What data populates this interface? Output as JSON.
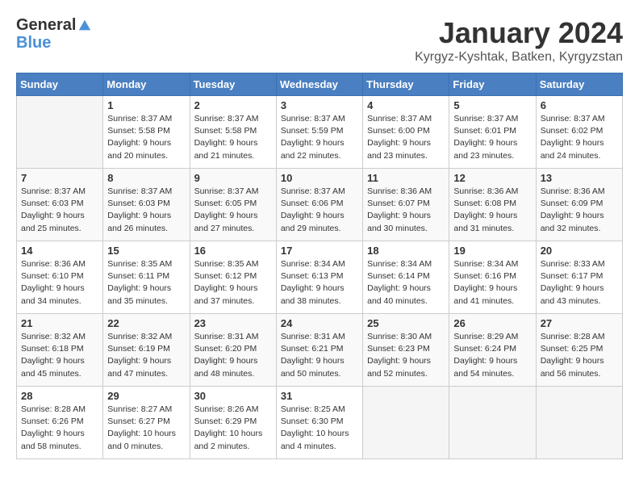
{
  "logo": {
    "line1": "General",
    "line2": "Blue"
  },
  "title": "January 2024",
  "location": "Kyrgyz-Kyshtak, Batken, Kyrgyzstan",
  "weekdays": [
    "Sunday",
    "Monday",
    "Tuesday",
    "Wednesday",
    "Thursday",
    "Friday",
    "Saturday"
  ],
  "weeks": [
    [
      {
        "day": "",
        "info": ""
      },
      {
        "day": "1",
        "info": "Sunrise: 8:37 AM\nSunset: 5:58 PM\nDaylight: 9 hours\nand 20 minutes."
      },
      {
        "day": "2",
        "info": "Sunrise: 8:37 AM\nSunset: 5:58 PM\nDaylight: 9 hours\nand 21 minutes."
      },
      {
        "day": "3",
        "info": "Sunrise: 8:37 AM\nSunset: 5:59 PM\nDaylight: 9 hours\nand 22 minutes."
      },
      {
        "day": "4",
        "info": "Sunrise: 8:37 AM\nSunset: 6:00 PM\nDaylight: 9 hours\nand 23 minutes."
      },
      {
        "day": "5",
        "info": "Sunrise: 8:37 AM\nSunset: 6:01 PM\nDaylight: 9 hours\nand 23 minutes."
      },
      {
        "day": "6",
        "info": "Sunrise: 8:37 AM\nSunset: 6:02 PM\nDaylight: 9 hours\nand 24 minutes."
      }
    ],
    [
      {
        "day": "7",
        "info": ""
      },
      {
        "day": "8",
        "info": "Sunrise: 8:37 AM\nSunset: 6:03 PM\nDaylight: 9 hours\nand 26 minutes."
      },
      {
        "day": "9",
        "info": "Sunrise: 8:37 AM\nSunset: 6:05 PM\nDaylight: 9 hours\nand 27 minutes."
      },
      {
        "day": "10",
        "info": "Sunrise: 8:37 AM\nSunset: 6:06 PM\nDaylight: 9 hours\nand 29 minutes."
      },
      {
        "day": "11",
        "info": "Sunrise: 8:36 AM\nSunset: 6:07 PM\nDaylight: 9 hours\nand 30 minutes."
      },
      {
        "day": "12",
        "info": "Sunrise: 8:36 AM\nSunset: 6:08 PM\nDaylight: 9 hours\nand 31 minutes."
      },
      {
        "day": "13",
        "info": "Sunrise: 8:36 AM\nSunset: 6:09 PM\nDaylight: 9 hours\nand 32 minutes."
      }
    ],
    [
      {
        "day": "14",
        "info": ""
      },
      {
        "day": "15",
        "info": "Sunrise: 8:35 AM\nSunset: 6:11 PM\nDaylight: 9 hours\nand 35 minutes."
      },
      {
        "day": "16",
        "info": "Sunrise: 8:35 AM\nSunset: 6:12 PM\nDaylight: 9 hours\nand 37 minutes."
      },
      {
        "day": "17",
        "info": "Sunrise: 8:34 AM\nSunset: 6:13 PM\nDaylight: 9 hours\nand 38 minutes."
      },
      {
        "day": "18",
        "info": "Sunrise: 8:34 AM\nSunset: 6:14 PM\nDaylight: 9 hours\nand 40 minutes."
      },
      {
        "day": "19",
        "info": "Sunrise: 8:34 AM\nSunset: 6:16 PM\nDaylight: 9 hours\nand 41 minutes."
      },
      {
        "day": "20",
        "info": "Sunrise: 8:33 AM\nSunset: 6:17 PM\nDaylight: 9 hours\nand 43 minutes."
      }
    ],
    [
      {
        "day": "21",
        "info": ""
      },
      {
        "day": "22",
        "info": "Sunrise: 8:32 AM\nSunset: 6:19 PM\nDaylight: 9 hours\nand 47 minutes."
      },
      {
        "day": "23",
        "info": "Sunrise: 8:31 AM\nSunset: 6:20 PM\nDaylight: 9 hours\nand 48 minutes."
      },
      {
        "day": "24",
        "info": "Sunrise: 8:31 AM\nSunset: 6:21 PM\nDaylight: 9 hours\nand 50 minutes."
      },
      {
        "day": "25",
        "info": "Sunrise: 8:30 AM\nSunset: 6:23 PM\nDaylight: 9 hours\nand 52 minutes."
      },
      {
        "day": "26",
        "info": "Sunrise: 8:29 AM\nSunset: 6:24 PM\nDaylight: 9 hours\nand 54 minutes."
      },
      {
        "day": "27",
        "info": "Sunrise: 8:28 AM\nSunset: 6:25 PM\nDaylight: 9 hours\nand 56 minutes."
      }
    ],
    [
      {
        "day": "28",
        "info": ""
      },
      {
        "day": "29",
        "info": "Sunrise: 8:27 AM\nSunset: 6:27 PM\nDaylight: 10 hours\nand 0 minutes."
      },
      {
        "day": "30",
        "info": "Sunrise: 8:26 AM\nSunset: 6:29 PM\nDaylight: 10 hours\nand 2 minutes."
      },
      {
        "day": "31",
        "info": "Sunrise: 8:25 AM\nSunset: 6:30 PM\nDaylight: 10 hours\nand 4 minutes."
      },
      {
        "day": "",
        "info": ""
      },
      {
        "day": "",
        "info": ""
      },
      {
        "day": "",
        "info": ""
      }
    ]
  ],
  "week1_sun_info": "Sunrise: 8:37 AM\nSunset: 6:03 PM\nDaylight: 9 hours\nand 25 minutes.",
  "week3_sun_info": "Sunrise: 8:36 AM\nSunset: 6:10 PM\nDaylight: 9 hours\nand 34 minutes.",
  "week4_sun_info": "Sunrise: 8:32 AM\nSunset: 6:18 PM\nDaylight: 9 hours\nand 45 minutes.",
  "week5_sun_info": "Sunrise: 8:28 AM\nSunset: 6:26 PM\nDaylight: 9 hours\nand 58 minutes."
}
